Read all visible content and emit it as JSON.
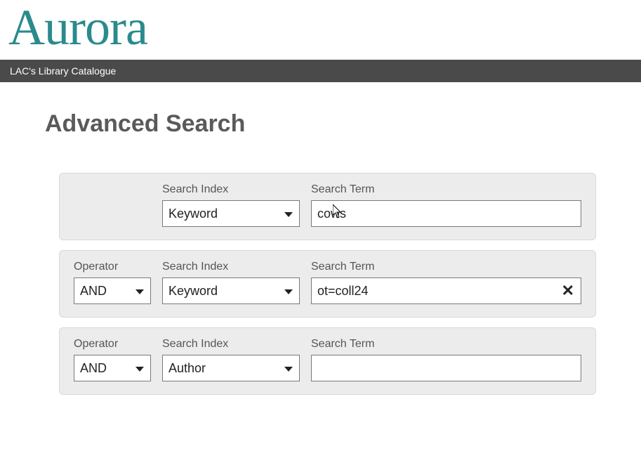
{
  "logo_text": "Aurora",
  "topbar_text": "LAC's Library Catalogue",
  "page_title": "Advanced Search",
  "labels": {
    "operator": "Operator",
    "search_index": "Search Index",
    "search_term": "Search Term"
  },
  "rows": [
    {
      "index_value": "Keyword",
      "term_value": "cows"
    },
    {
      "operator_value": "AND",
      "index_value": "Keyword",
      "term_value": "ot=coll24"
    },
    {
      "operator_value": "AND",
      "index_value": "Author",
      "term_value": ""
    }
  ]
}
